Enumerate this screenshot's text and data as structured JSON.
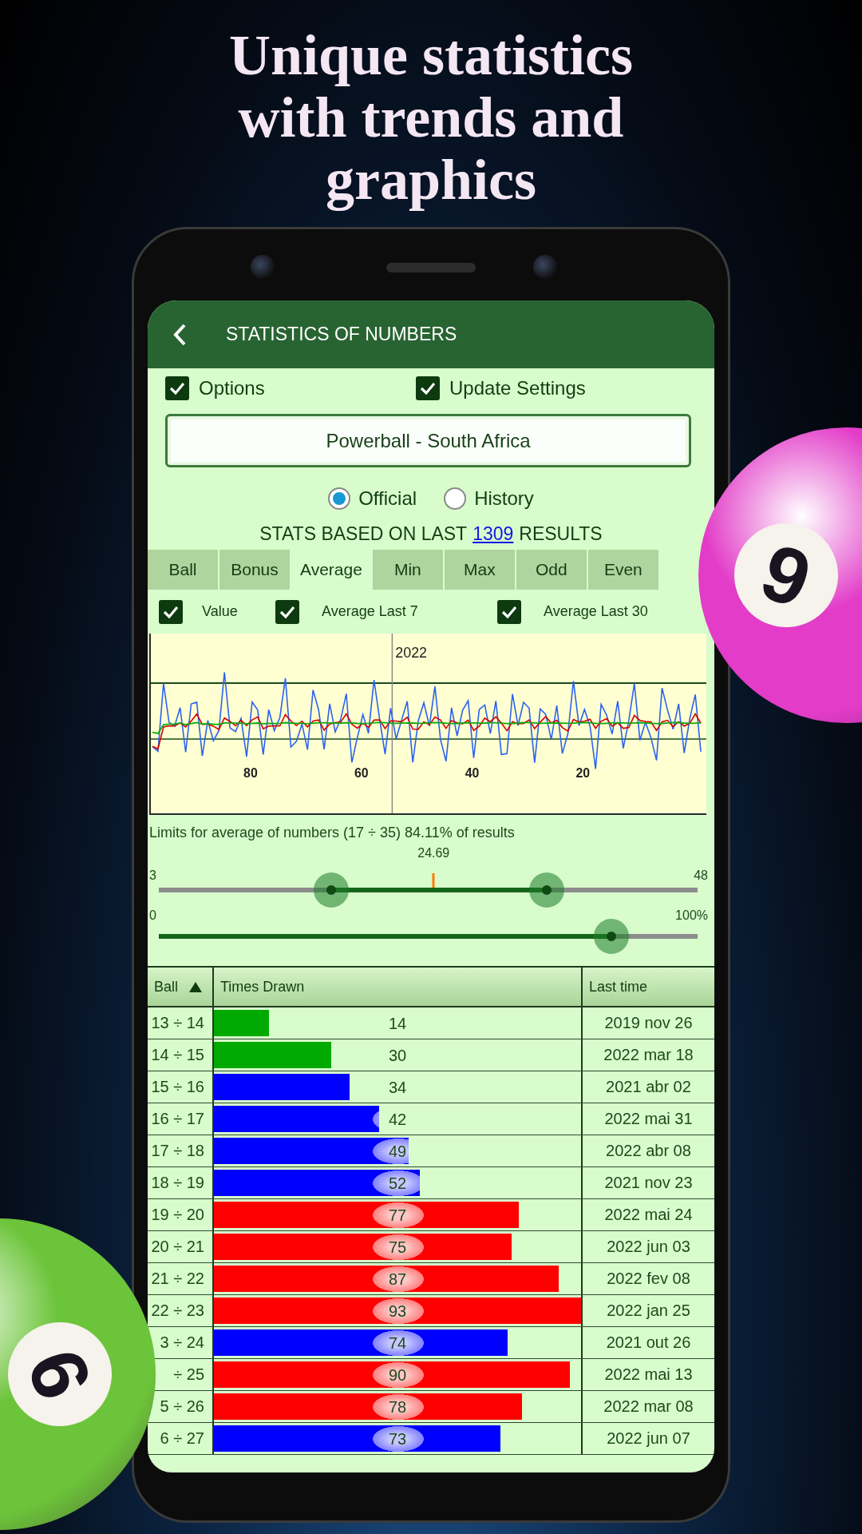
{
  "headline": "Unique statistics with trends and graphics",
  "balls": [
    {
      "number": "9",
      "color": "#e23cc8"
    },
    {
      "number": "6",
      "color": "#6cc43a"
    }
  ],
  "app_bar": {
    "title": "STATISTICS OF NUMBERS"
  },
  "options": [
    {
      "label": "Options",
      "checked": true
    },
    {
      "label": "Update Settings",
      "checked": true
    }
  ],
  "lottery_field": {
    "value": "Powerball - South Africa"
  },
  "source": [
    {
      "label": "Official",
      "selected": true
    },
    {
      "label": "History",
      "selected": false
    }
  ],
  "stats_heading": {
    "before": "STATS BASED ON LAST",
    "link": "1309",
    "after": "RESULTS"
  },
  "tabs": [
    {
      "label": "Ball",
      "selected": false
    },
    {
      "label": "Bonus",
      "selected": false
    },
    {
      "label": "Average",
      "selected": true
    },
    {
      "label": "Min",
      "selected": false
    },
    {
      "label": "Max",
      "selected": false
    },
    {
      "label": "Odd",
      "selected": false
    },
    {
      "label": "Even",
      "selected": false
    }
  ],
  "series_toggles": [
    {
      "label": "Value",
      "checked": true
    },
    {
      "label": "Average Last 7",
      "checked": true
    },
    {
      "label": "Average Last 30",
      "checked": true
    }
  ],
  "trend_chart": {
    "year_label": "2022",
    "x_labels": [
      "80",
      "60",
      "40",
      "20"
    ]
  },
  "limits_text": "Limits for average of numbers (17 ÷ 35) 84.11% of results",
  "range_slider": {
    "min_label": "3",
    "max_label": "48",
    "marker": {
      "label": "24.69",
      "level": 0.51
    },
    "low": {
      "level": 0.32
    },
    "high": {
      "level": 0.72
    }
  },
  "coverage_slider": {
    "min_label": "0",
    "max_label": "100%",
    "level": 0.84
  },
  "table": {
    "columns": [
      {
        "label": "Ball",
        "sorted": true
      },
      {
        "label": "Times Drawn"
      },
      {
        "label": "Last time"
      }
    ],
    "rows": [
      {
        "ball": "13 ÷ 14",
        "count": "14",
        "level": 0.15,
        "color": "#00aa00",
        "last": "2019 nov 26"
      },
      {
        "ball": "14 ÷ 15",
        "count": "30",
        "level": 0.32,
        "color": "#00aa00",
        "last": "2022 mar 18"
      },
      {
        "ball": "15 ÷ 16",
        "count": "34",
        "level": 0.37,
        "color": "#0000ff",
        "last": "2021 abr 02"
      },
      {
        "ball": "16 ÷ 17",
        "count": "42",
        "level": 0.45,
        "color": "#0000ff",
        "last": "2022 mai 31"
      },
      {
        "ball": "17 ÷ 18",
        "count": "49",
        "level": 0.53,
        "color": "#0000ff",
        "last": "2022 abr 08"
      },
      {
        "ball": "18 ÷ 19",
        "count": "52",
        "level": 0.56,
        "color": "#0000ff",
        "last": "2021 nov 23"
      },
      {
        "ball": "19 ÷ 20",
        "count": "77",
        "level": 0.83,
        "color": "#ff0000",
        "last": "2022 mai 24"
      },
      {
        "ball": "20 ÷ 21",
        "count": "75",
        "level": 0.81,
        "color": "#ff0000",
        "last": "2022 jun 03"
      },
      {
        "ball": "21 ÷ 22",
        "count": "87",
        "level": 0.94,
        "color": "#ff0000",
        "last": "2022 fev 08"
      },
      {
        "ball": "22 ÷ 23",
        "count": "93",
        "level": 1,
        "color": "#ff0000",
        "last": "2022 jan 25"
      },
      {
        "ball": "3 ÷ 24",
        "count": "74",
        "level": 0.8,
        "color": "#0000ff",
        "last": "2021 out 26"
      },
      {
        "ball": "÷ 25",
        "count": "90",
        "level": 0.97,
        "color": "#ff0000",
        "last": "2022 mai 13"
      },
      {
        "ball": "5 ÷ 26",
        "count": "78",
        "level": 0.84,
        "color": "#ff0000",
        "last": "2022 mar 08"
      },
      {
        "ball": "6 ÷ 27",
        "count": "73",
        "level": 0.78,
        "color": "#0000ff",
        "last": "2022 jun 07"
      }
    ]
  }
}
